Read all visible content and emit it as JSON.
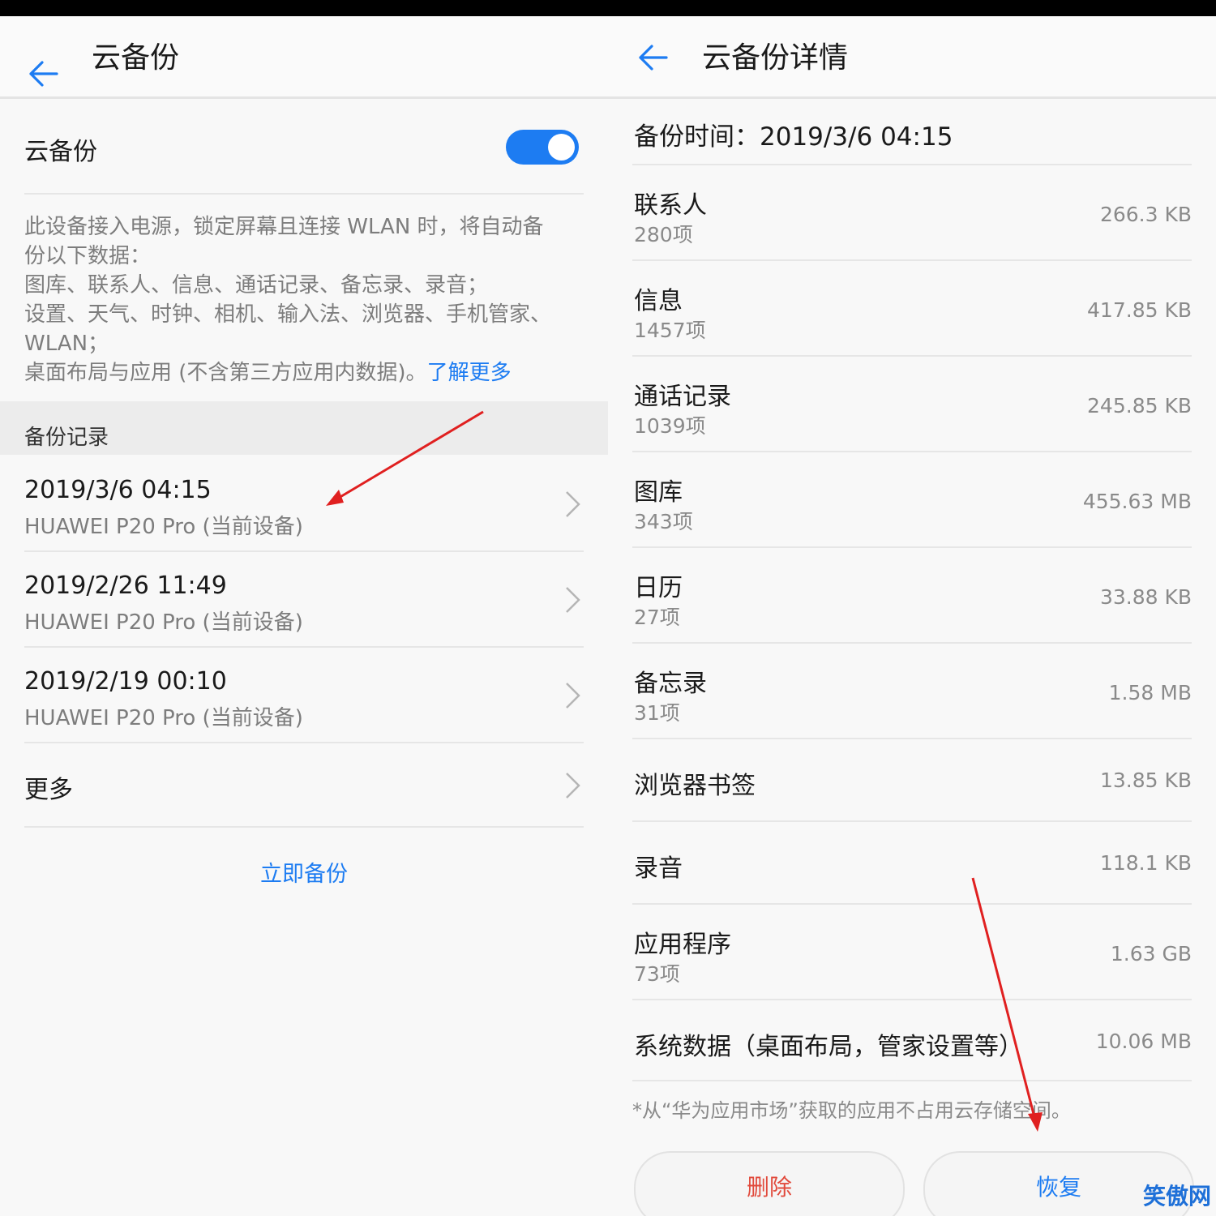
{
  "left": {
    "title": "云备份",
    "toggle": {
      "label": "云备份",
      "on": true
    },
    "description": [
      "此设备接入电源，锁定屏幕且连接 WLAN 时，将自动备",
      "份以下数据：",
      "图库、联系人、信息、通话记录、备忘录、录音；",
      "设置、天气、时钟、相机、输入法、浏览器、手机管家、",
      "WLAN；"
    ],
    "description_last": "桌面布局与应用 (不含第三方应用内数据)。",
    "learn_more": "了解更多",
    "section_header": "备份记录",
    "records": [
      {
        "date": "2019/3/6 04:15",
        "device": "HUAWEI P20 Pro (当前设备)"
      },
      {
        "date": "2019/2/26 11:49",
        "device": "HUAWEI P20 Pro (当前设备)"
      },
      {
        "date": "2019/2/19 00:10",
        "device": "HUAWEI P20 Pro (当前设备)"
      }
    ],
    "more": "更多",
    "backup_now": "立即备份"
  },
  "right": {
    "title": "云备份详情",
    "backup_time": "备份时间：2019/3/6 04:15",
    "items": [
      {
        "name": "联系人",
        "count": "280项",
        "size": "266.3 KB"
      },
      {
        "name": "信息",
        "count": "1457项",
        "size": "417.85 KB"
      },
      {
        "name": "通话记录",
        "count": "1039项",
        "size": "245.85 KB"
      },
      {
        "name": "图库",
        "count": "343项",
        "size": "455.63 MB"
      },
      {
        "name": "日历",
        "count": "27项",
        "size": "33.88 KB"
      },
      {
        "name": "备忘录",
        "count": "31项",
        "size": "1.58 MB"
      },
      {
        "name": "浏览器书签",
        "count": "",
        "size": "13.85 KB"
      },
      {
        "name": "录音",
        "count": "",
        "size": "118.1 KB"
      },
      {
        "name": "应用程序",
        "count": "73项",
        "size": "1.63 GB"
      },
      {
        "name": "系统数据（桌面布局，管家设置等）",
        "count": "",
        "size": "10.06 MB"
      }
    ],
    "note": "*从“华为应用市场”获取的应用不占用云存储空间。",
    "delete_label": "删除",
    "restore_label": "恢复"
  },
  "watermark": "笑傲网",
  "colors": {
    "accent": "#1d7cf2",
    "danger": "#e14a3c",
    "arrow": "#e02020"
  }
}
